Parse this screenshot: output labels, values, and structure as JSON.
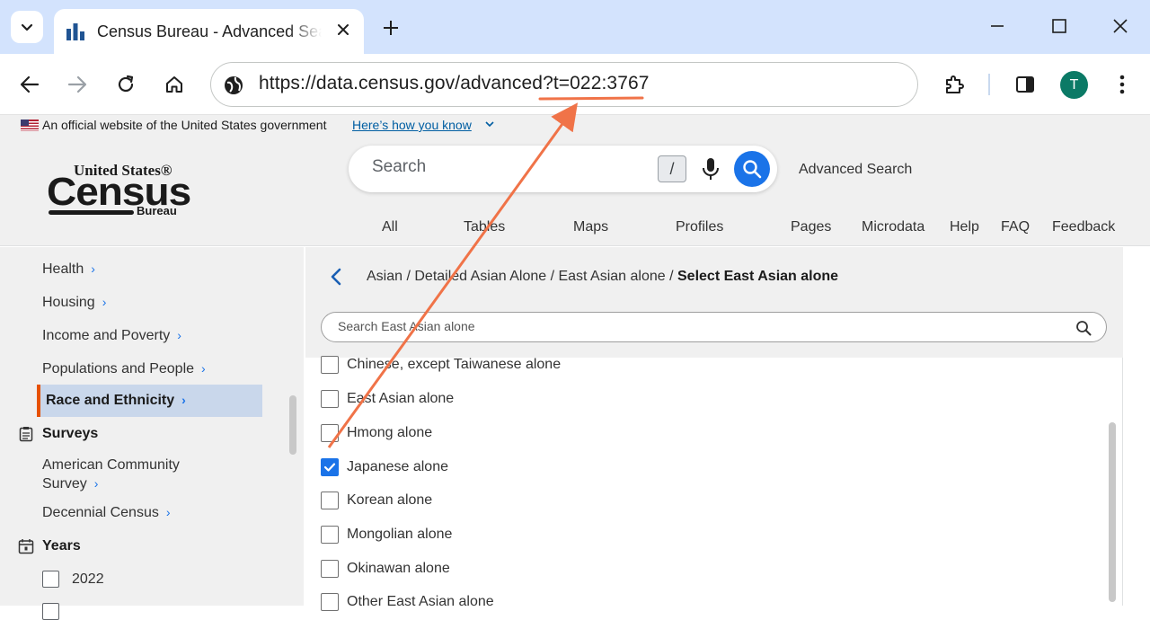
{
  "browser": {
    "tab_title": "Census Bureau - Advanced Search",
    "url": "https://data.census.gov/advanced?t=022:3767",
    "profile_initial": "T"
  },
  "gov_banner": {
    "text": "An official website of the United States government",
    "link": "Here’s how you know"
  },
  "logo": {
    "line1": "United States®",
    "line2": "Census",
    "line3": "Bureau"
  },
  "search": {
    "placeholder": "Search",
    "shortcut_key": "/",
    "advanced_link": "Advanced Search"
  },
  "nav": [
    "All",
    "Tables",
    "Maps",
    "Profiles",
    "Pages",
    "Microdata",
    "Help",
    "FAQ",
    "Feedback"
  ],
  "sidebar": {
    "topics": [
      "Health",
      "Housing",
      "Income and Poverty",
      "Populations and People"
    ],
    "active_topic": "Race and Ethnicity",
    "surveys_heading": "Surveys",
    "surveys": [
      "American Community",
      "Survey",
      "Decennial Census"
    ],
    "years_heading": "Years",
    "years": [
      "2022"
    ]
  },
  "panel": {
    "breadcrumb": "Asian / Detailed Asian Alone / East Asian alone / ",
    "breadcrumb_current": "Select East Asian alone",
    "filter_placeholder": "Search East Asian alone",
    "options": [
      {
        "label": "Chinese, except Taiwanese alone",
        "checked": false
      },
      {
        "label": "East Asian alone",
        "checked": false
      },
      {
        "label": "Hmong alone",
        "checked": false
      },
      {
        "label": "Japanese alone",
        "checked": true
      },
      {
        "label": "Korean alone",
        "checked": false
      },
      {
        "label": "Mongolian alone",
        "checked": false
      },
      {
        "label": "Okinawan alone",
        "checked": false
      },
      {
        "label": "Other East Asian alone",
        "checked": false
      }
    ]
  },
  "colors": {
    "tabstrip": "#d3e3fd",
    "accent": "#1a73e8",
    "annotation": "#f07348",
    "active_bar": "#e65100"
  }
}
